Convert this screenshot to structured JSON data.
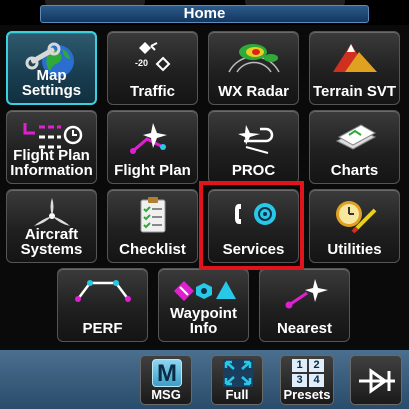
{
  "header": {
    "title": "Home"
  },
  "tiles": [
    {
      "label": "Map\nSettings",
      "icon": "map-settings-icon"
    },
    {
      "label": "Traffic",
      "icon": "traffic-icon",
      "icon_text": "-20"
    },
    {
      "label": "WX Radar",
      "icon": "wx-radar-icon"
    },
    {
      "label": "Terrain SVT",
      "icon": "terrain-svt-icon"
    },
    {
      "label": "Flight Plan\nInformation",
      "icon": "flight-plan-information-icon"
    },
    {
      "label": "Flight Plan",
      "icon": "flight-plan-icon"
    },
    {
      "label": "PROC",
      "icon": "proc-icon"
    },
    {
      "label": "Charts",
      "icon": "charts-icon"
    },
    {
      "label": "Aircraft\nSystems",
      "icon": "aircraft-systems-icon"
    },
    {
      "label": "Checklist",
      "icon": "checklist-icon"
    },
    {
      "label": "Services",
      "icon": "services-icon"
    },
    {
      "label": "Utilities",
      "icon": "utilities-icon"
    },
    {
      "label": "PERF",
      "icon": "perf-icon"
    },
    {
      "label": "Waypoint\nInfo",
      "icon": "waypoint-info-icon"
    },
    {
      "label": "Nearest",
      "icon": "nearest-icon"
    }
  ],
  "bottom": {
    "msg": {
      "label": "MSG",
      "icon_letter": "M"
    },
    "full": {
      "label": "Full"
    },
    "presets": {
      "label": "Presets",
      "digits": [
        "1",
        "2",
        "3",
        "4"
      ]
    },
    "back": {
      "icon": "back-arrow-icon"
    }
  },
  "colors": {
    "accent": "#3ad0e0",
    "highlight": "#e0141c",
    "magenta": "#e020d0",
    "cyan": "#28c8e8"
  }
}
